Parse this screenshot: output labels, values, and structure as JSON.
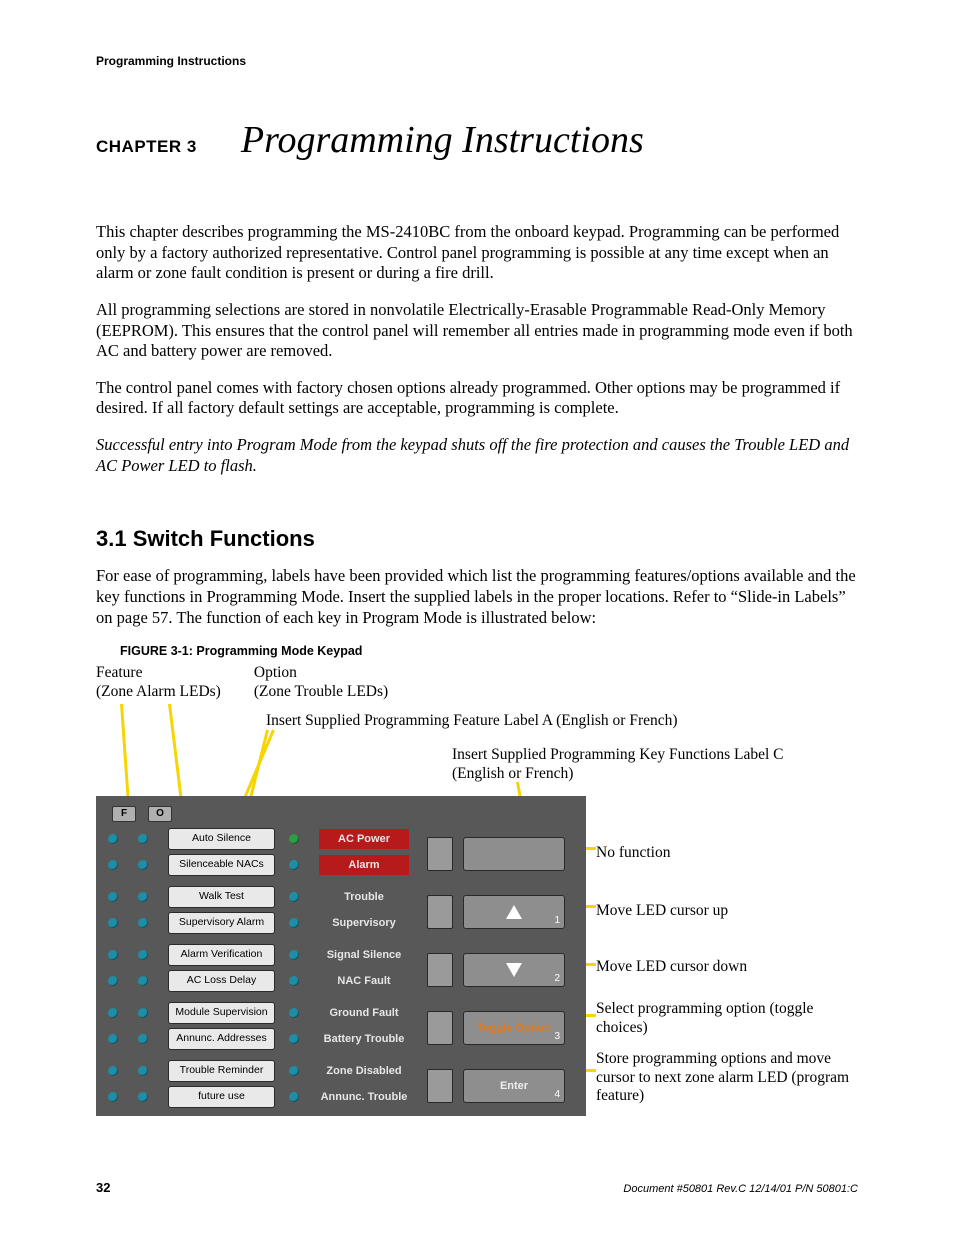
{
  "running_head": "Programming Instructions",
  "chapter": {
    "label": "CHAPTER 3",
    "title": "Programming Instructions"
  },
  "para1": "This chapter describes programming the MS-2410BC from the onboard keypad.  Programming can be performed only by a factory authorized representative.  Control panel programming is possible at any time except when an alarm or zone fault condition is present or during a fire drill.",
  "para2": "All programming selections are stored in nonvolatile Electrically-Erasable Programmable Read-Only Memory (EEPROM).  This ensures that the control panel will remember all entries made in programming mode even if both AC and battery power are removed.",
  "para3": "The control panel comes with factory chosen options already programmed.  Other options may be programmed if desired.  If all factory default settings are acceptable, programming is complete.",
  "para4": "Successful entry into Program Mode from the keypad shuts off the fire protection and causes the Trouble LED and AC Power LED to flash.",
  "section": {
    "num_title": "3.1    Switch Functions"
  },
  "section_para": "For ease of programming, labels have been provided which list the programming features/options available and the key functions in Programming Mode.  Insert the supplied labels in the proper locations.  Refer to “Slide-in Labels” on page 57.  The function of each key in Program Mode is illustrated below:",
  "figure": {
    "label": "FIGURE 3-1:",
    "title": "Programming Mode Keypad",
    "callouts": {
      "feature_l1": "Feature",
      "feature_l2": "(Zone Alarm LEDs)",
      "option_l1": "Option",
      "option_l2": "(Zone Trouble LEDs)",
      "insertA": "Insert Supplied Programming Feature Label A (English or French)",
      "insertC_l1": "Insert Supplied Programming Key Functions Label C",
      "insertC_l2": "(English or French)"
    },
    "fo": {
      "f": "F",
      "o": "O"
    },
    "feature_plates": [
      "Auto Silence",
      "Silenceable NACs",
      "Walk Test",
      "Supervisory Alarm",
      "Alarm Verification",
      "AC Loss Delay",
      "Module Supervision",
      "Annunc. Addresses",
      "Trouble Reminder",
      "future use"
    ],
    "status_labels": [
      "AC Power",
      "Alarm",
      "Trouble",
      "Supervisory",
      "Signal Silence",
      "NAC Fault",
      "Ground Fault",
      "Battery Trouble",
      "Zone Disabled",
      "Annunc. Trouble"
    ],
    "keys": [
      {
        "num": "",
        "label": "",
        "type": "blank"
      },
      {
        "num": "1",
        "label": "up",
        "type": "arrow-up"
      },
      {
        "num": "2",
        "label": "down",
        "type": "arrow-down"
      },
      {
        "num": "3",
        "label": "Toggle Option",
        "type": "text"
      },
      {
        "num": "4",
        "label": "Enter",
        "type": "text"
      }
    ],
    "right_callouts": [
      "No function",
      "Move LED cursor up",
      "Move LED cursor down",
      "Select programming option (toggle choices)",
      "Store programming options and move cursor to next zone alarm LED (program feature)"
    ]
  },
  "footer": {
    "page": "32",
    "meta": "Document #50801    Rev.C   12/14/01   P/N 50801:C"
  }
}
